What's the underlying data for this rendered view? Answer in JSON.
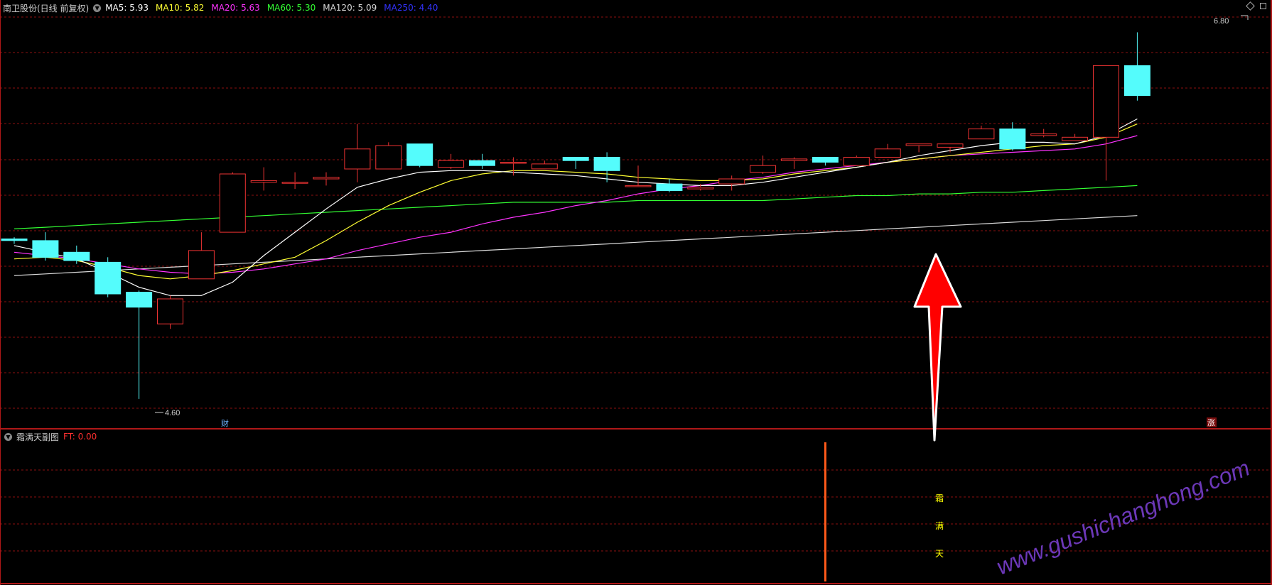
{
  "main_panel": {
    "stock_title": "南卫股份(日线 前复权)",
    "ma_labels": [
      {
        "text": "MA5: 5.93",
        "color": "#ffffff"
      },
      {
        "text": "MA10: 5.82",
        "color": "#ffff33"
      },
      {
        "text": "MA20: 5.63",
        "color": "#ff33ff"
      },
      {
        "text": "MA60: 5.30",
        "color": "#33ff33"
      },
      {
        "text": "MA120: 5.09",
        "color": "#d8d8d8"
      },
      {
        "text": "MA250: 4.40",
        "color": "#3333ff"
      }
    ],
    "high_marker": "6.80",
    "low_marker": "4.60",
    "event_label_cai": "财",
    "event_label_zhang": "涨"
  },
  "sub_panel": {
    "title": "霜满天副图",
    "indicator": "FT: 0.00",
    "signal_chars": [
      "霜",
      "满",
      "天"
    ]
  },
  "watermark": "www.gushichanghong.com",
  "colors": {
    "background": "#000000",
    "grid": "#8b1010",
    "up": "#ee3333",
    "down": "#54fcfc",
    "arrow": "#ff0000",
    "signal_bar": "#ff5a1a",
    "signal_text": "#ffff00",
    "watermark": "#6c38b8",
    "ma5": "#ffffff",
    "ma10": "#ffff33",
    "ma20": "#ff33ff",
    "ma60": "#33ff33",
    "ma120": "#d8d8d8"
  },
  "chart_data": {
    "type": "candlestick",
    "title": "南卫股份(日线 前复权)",
    "ylim": [
      4.48,
      6.9
    ],
    "candles": [
      {
        "o": 5.56,
        "c": 5.55,
        "h": 5.57,
        "l": 5.53
      },
      {
        "o": 5.55,
        "c": 5.45,
        "h": 5.6,
        "l": 5.43
      },
      {
        "o": 5.48,
        "c": 5.43,
        "h": 5.52,
        "l": 5.41
      },
      {
        "o": 5.42,
        "c": 5.23,
        "h": 5.45,
        "l": 5.21
      },
      {
        "o": 5.24,
        "c": 5.15,
        "h": 5.25,
        "l": 4.6
      },
      {
        "o": 5.05,
        "c": 5.2,
        "h": 5.22,
        "l": 5.02
      },
      {
        "o": 5.32,
        "c": 5.49,
        "h": 5.6,
        "l": 5.32
      },
      {
        "o": 5.6,
        "c": 5.95,
        "h": 5.96,
        "l": 5.6
      },
      {
        "o": 5.9,
        "c": 5.91,
        "h": 5.99,
        "l": 5.85
      },
      {
        "o": 5.9,
        "c": 5.9,
        "h": 5.96,
        "l": 5.86
      },
      {
        "o": 5.92,
        "c": 5.93,
        "h": 5.96,
        "l": 5.88
      },
      {
        "o": 5.98,
        "c": 6.1,
        "h": 6.25,
        "l": 5.9
      },
      {
        "o": 5.98,
        "c": 6.12,
        "h": 6.14,
        "l": 6.0
      },
      {
        "o": 6.13,
        "c": 6.0,
        "h": 6.13,
        "l": 5.99
      },
      {
        "o": 5.99,
        "c": 6.03,
        "h": 6.07,
        "l": 5.98
      },
      {
        "o": 6.03,
        "c": 6.0,
        "h": 6.07,
        "l": 5.98
      },
      {
        "o": 6.02,
        "c": 6.02,
        "h": 6.05,
        "l": 5.94
      },
      {
        "o": 5.98,
        "c": 6.01,
        "h": 6.03,
        "l": 5.98
      },
      {
        "o": 6.05,
        "c": 6.03,
        "h": 6.05,
        "l": 5.98
      },
      {
        "o": 6.05,
        "c": 5.97,
        "h": 6.08,
        "l": 5.9
      },
      {
        "o": 5.88,
        "c": 5.88,
        "h": 6.0,
        "l": 5.88
      },
      {
        "o": 5.89,
        "c": 5.85,
        "h": 5.92,
        "l": 5.84
      },
      {
        "o": 5.86,
        "c": 5.87,
        "h": 5.89,
        "l": 5.85
      },
      {
        "o": 5.89,
        "c": 5.92,
        "h": 5.94,
        "l": 5.85
      },
      {
        "o": 5.96,
        "c": 6.0,
        "h": 6.06,
        "l": 5.95
      },
      {
        "o": 6.03,
        "c": 6.04,
        "h": 6.05,
        "l": 5.98
      },
      {
        "o": 6.05,
        "c": 6.02,
        "h": 6.05,
        "l": 6.0
      },
      {
        "o": 6.0,
        "c": 6.05,
        "h": 6.06,
        "l": 6.0
      },
      {
        "o": 6.05,
        "c": 6.1,
        "h": 6.13,
        "l": 6.05
      },
      {
        "o": 6.12,
        "c": 6.13,
        "h": 6.13,
        "l": 6.08
      },
      {
        "o": 6.11,
        "c": 6.13,
        "h": 6.13,
        "l": 6.08
      },
      {
        "o": 6.16,
        "c": 6.22,
        "h": 6.24,
        "l": 6.16
      },
      {
        "o": 6.22,
        "c": 6.1,
        "h": 6.26,
        "l": 6.09
      },
      {
        "o": 6.18,
        "c": 6.19,
        "h": 6.22,
        "l": 6.17
      },
      {
        "o": 6.15,
        "c": 6.17,
        "h": 6.19,
        "l": 6.15
      },
      {
        "o": 6.17,
        "c": 6.6,
        "h": 6.6,
        "l": 5.91
      },
      {
        "o": 6.6,
        "c": 6.42,
        "h": 6.8,
        "l": 6.39
      }
    ],
    "ma5": [
      5.52,
      5.48,
      5.44,
      5.36,
      5.27,
      5.22,
      5.22,
      5.3,
      5.46,
      5.6,
      5.74,
      5.87,
      5.92,
      5.96,
      5.97,
      5.97,
      5.96,
      5.95,
      5.94,
      5.92,
      5.9,
      5.89,
      5.88,
      5.88,
      5.9,
      5.93,
      5.96,
      5.99,
      6.02,
      6.06,
      6.09,
      6.12,
      6.14,
      6.14,
      6.13,
      6.18,
      6.28
    ],
    "ma10": [
      5.44,
      5.45,
      5.43,
      5.39,
      5.34,
      5.32,
      5.34,
      5.37,
      5.41,
      5.45,
      5.55,
      5.66,
      5.76,
      5.84,
      5.91,
      5.95,
      5.97,
      5.97,
      5.96,
      5.95,
      5.93,
      5.92,
      5.91,
      5.91,
      5.92,
      5.95,
      5.97,
      5.99,
      6.02,
      6.04,
      6.06,
      6.08,
      6.1,
      6.12,
      6.13,
      6.17,
      6.25
    ],
    "ma20": [
      5.48,
      5.46,
      5.44,
      5.41,
      5.38,
      5.36,
      5.35,
      5.36,
      5.38,
      5.41,
      5.44,
      5.49,
      5.53,
      5.57,
      5.6,
      5.65,
      5.69,
      5.72,
      5.76,
      5.79,
      5.83,
      5.86,
      5.88,
      5.91,
      5.93,
      5.96,
      5.98,
      6.0,
      6.02,
      6.04,
      6.06,
      6.07,
      6.08,
      6.09,
      6.1,
      6.13,
      6.18
    ],
    "ma60": [
      5.62,
      5.63,
      5.64,
      5.65,
      5.66,
      5.67,
      5.68,
      5.69,
      5.7,
      5.71,
      5.72,
      5.73,
      5.74,
      5.75,
      5.76,
      5.77,
      5.78,
      5.78,
      5.78,
      5.78,
      5.79,
      5.79,
      5.79,
      5.79,
      5.79,
      5.8,
      5.81,
      5.82,
      5.82,
      5.83,
      5.83,
      5.84,
      5.84,
      5.85,
      5.86,
      5.87,
      5.88
    ],
    "ma120": [
      5.34,
      5.35,
      5.36,
      5.37,
      5.38,
      5.39,
      5.4,
      5.41,
      5.42,
      5.43,
      5.44,
      5.45,
      5.46,
      5.47,
      5.48,
      5.49,
      5.5,
      5.51,
      5.52,
      5.53,
      5.54,
      5.55,
      5.56,
      5.57,
      5.58,
      5.59,
      5.6,
      5.61,
      5.62,
      5.63,
      5.64,
      5.65,
      5.66,
      5.67,
      5.68,
      5.69,
      5.7
    ],
    "signal_index": 26,
    "ft_value": 0.0
  }
}
